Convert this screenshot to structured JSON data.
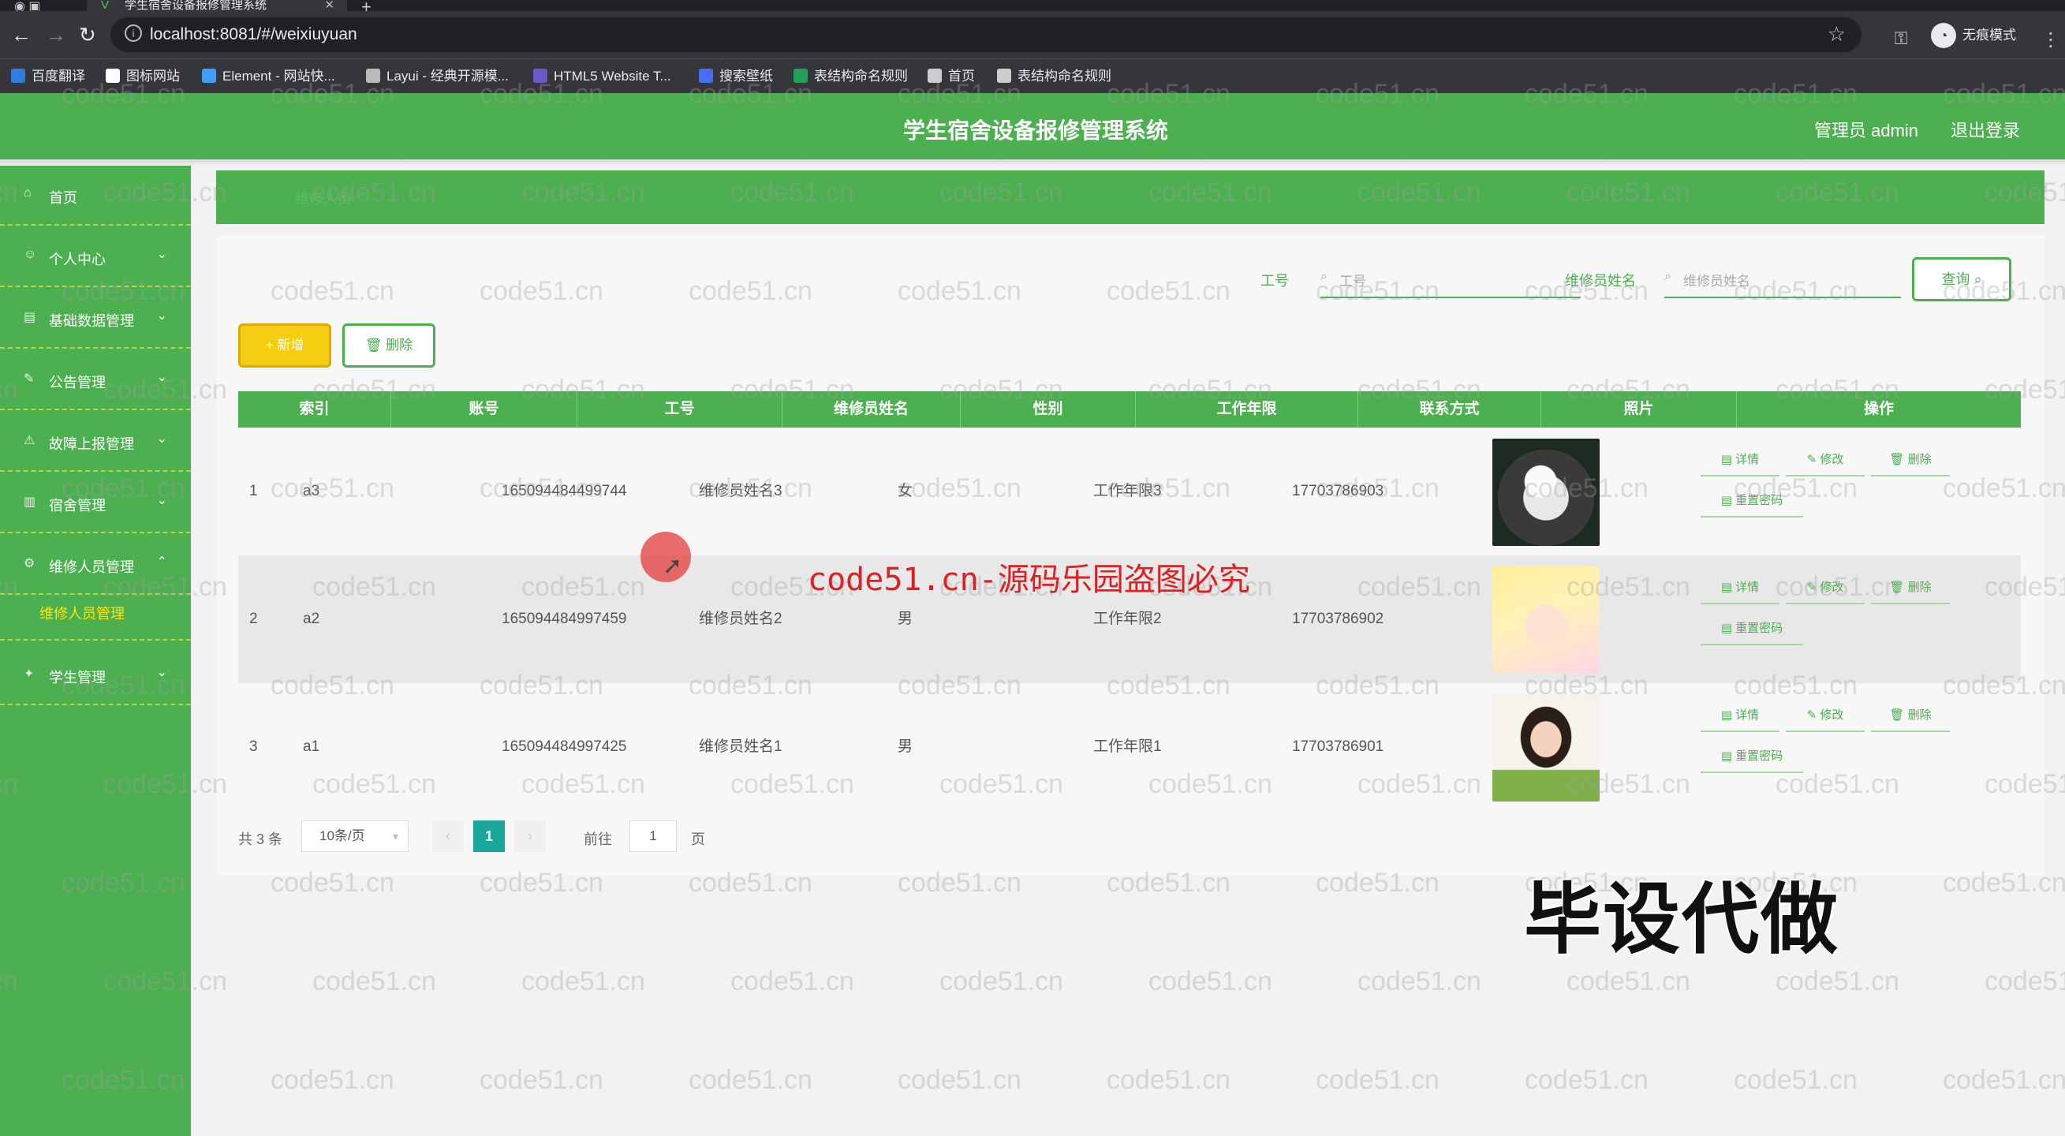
{
  "browser": {
    "tab_title": "学生宿舍设备报修管理系统",
    "url": "localhost:8081/#/weixiuyuan",
    "incognito_label": "无痕模式",
    "bookmarks": [
      {
        "label": "百度翻译",
        "color": "#2f7de1"
      },
      {
        "label": "图标网站",
        "color": "#ffffff"
      },
      {
        "label": "Element - 网站快...",
        "color": "#409eff"
      },
      {
        "label": "Layui - 经典开源模...",
        "color": "#bbbbbb"
      },
      {
        "label": "HTML5 Website T...",
        "color": "#6b58c9"
      },
      {
        "label": "搜索壁纸",
        "color": "#4a6cf0"
      },
      {
        "label": "表结构命名规则",
        "color": "#22a05a"
      },
      {
        "label": "首页",
        "color": "#cccccc"
      },
      {
        "label": "表结构命名规则",
        "color": "#cccccc"
      }
    ]
  },
  "header": {
    "title": "学生宿舍设备报修管理系统",
    "user": "管理员 admin",
    "logout": "退出登录"
  },
  "sidebar": {
    "items": [
      {
        "label": "首页",
        "expanded": null
      },
      {
        "label": "个人中心",
        "expanded": false
      },
      {
        "label": "基础数据管理",
        "expanded": false
      },
      {
        "label": "公告管理",
        "expanded": false
      },
      {
        "label": "故障上报管理",
        "expanded": false
      },
      {
        "label": "宿舍管理",
        "expanded": false
      },
      {
        "label": "维修人员管理",
        "expanded": true
      },
      {
        "label": "学生管理",
        "expanded": false
      }
    ],
    "active_sub": "维修人员管理"
  },
  "breadcrumb": "维修人员",
  "search": {
    "field1_label": "工号",
    "field1_placeholder": "工号",
    "field2_label": "维修员姓名",
    "field2_placeholder": "维修员姓名",
    "query_button": "查询"
  },
  "toolbar": {
    "add_label": "+ 新增",
    "delete_label": "删除"
  },
  "table": {
    "columns": [
      "索引",
      "账号",
      "工号",
      "维修员姓名",
      "性别",
      "工作年限",
      "联系方式",
      "照片",
      "操作"
    ],
    "rows": [
      {
        "index": "1",
        "account": "a3",
        "job_no": "165094484499744",
        "name": "维修员姓名3",
        "gender": "女",
        "years": "工作年限3",
        "phone": "17703786903",
        "photo": "cat"
      },
      {
        "index": "2",
        "account": "a2",
        "job_no": "165094484997459",
        "name": "维修员姓名2",
        "gender": "男",
        "years": "工作年限2",
        "phone": "17703786902",
        "photo": "anime-girl"
      },
      {
        "index": "3",
        "account": "a1",
        "job_no": "165094484997425",
        "name": "维修员姓名1",
        "gender": "男",
        "years": "工作年限1",
        "phone": "17703786901",
        "photo": "girl"
      }
    ],
    "row_actions": {
      "detail": "详情",
      "edit": "修改",
      "delete": "删除",
      "reset": "重置密码"
    }
  },
  "pagination": {
    "total": "共 3 条",
    "page_size": "10条/页",
    "current": "1",
    "goto_label": "前往",
    "goto_value": "1",
    "page_unit": "页"
  },
  "overlays": {
    "watermark": "code51.cn",
    "red_watermark": "code51.cn-源码乐园盗图必究",
    "stamp": "毕设代做"
  },
  "colors": {
    "primary_green": "#4caf50",
    "add_yellow": "#f5cd12",
    "pager_teal": "#1aa79b",
    "active_sub": "#ffe600"
  }
}
